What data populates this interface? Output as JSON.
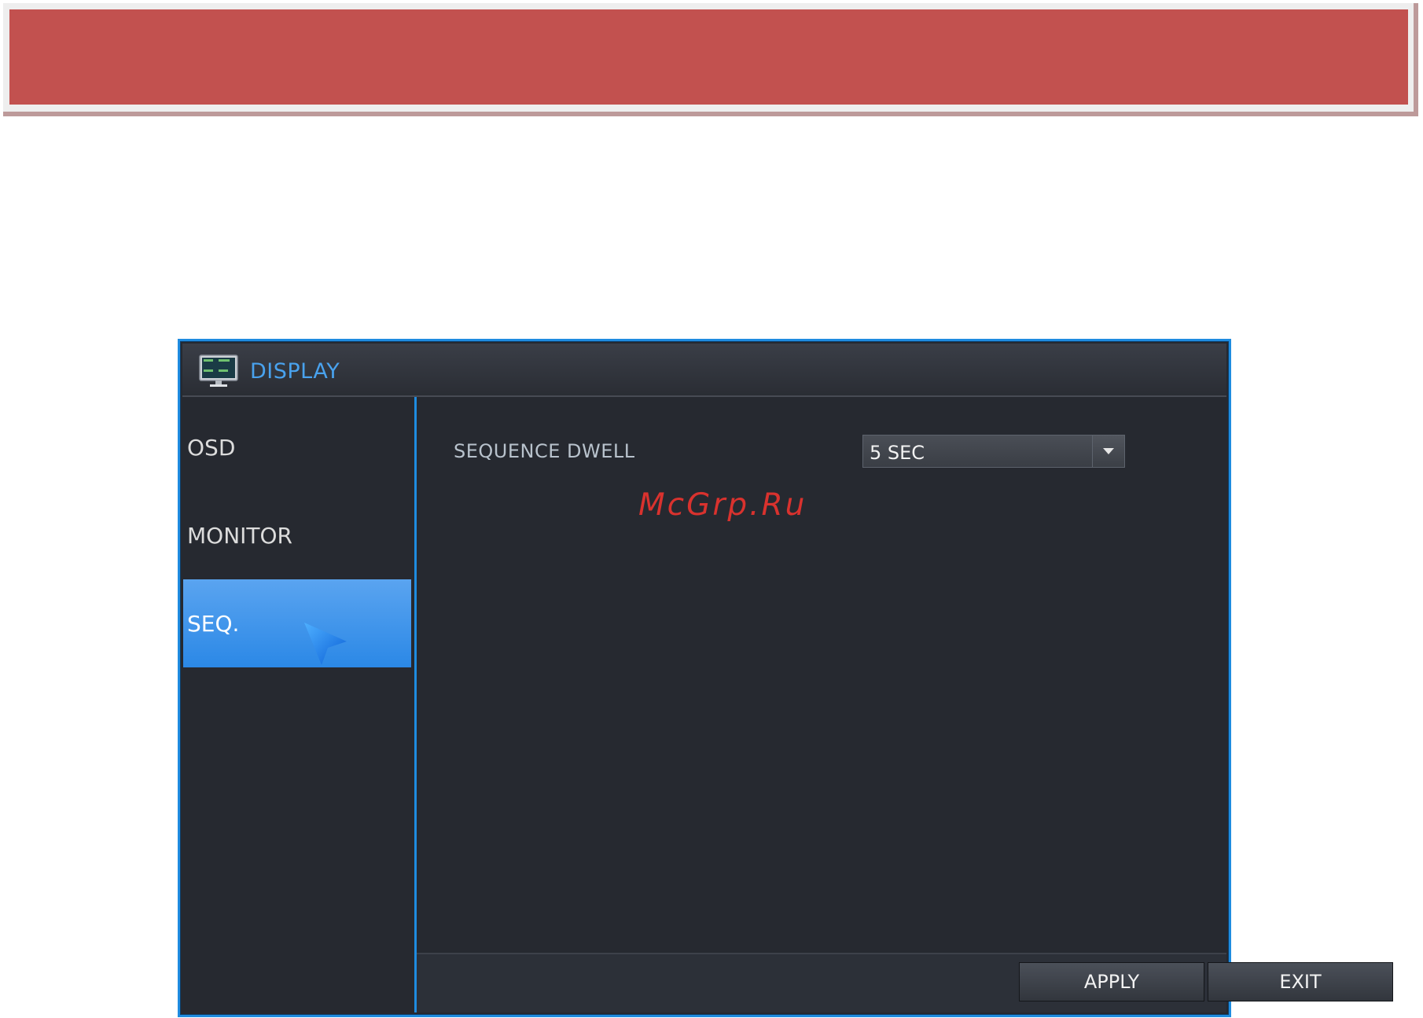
{
  "window": {
    "title": "DISPLAY",
    "icon": "monitor-icon"
  },
  "sidebar": {
    "items": [
      {
        "label": "OSD",
        "selected": false
      },
      {
        "label": "MONITOR",
        "selected": false
      },
      {
        "label": "SEQ.",
        "selected": true
      }
    ]
  },
  "settings": {
    "sequence_dwell": {
      "label": "SEQUENCE DWELL",
      "value": "5 SEC"
    }
  },
  "footer": {
    "apply_label": "APPLY",
    "exit_label": "EXIT"
  },
  "watermark": "McGrp.Ru",
  "colors": {
    "header_band": "#c2514f",
    "accent_blue": "#1f8ce0",
    "selected_item": "#3a94ea",
    "window_bg": "#262930",
    "title_text": "#49a2ee",
    "watermark": "#d9322e"
  }
}
